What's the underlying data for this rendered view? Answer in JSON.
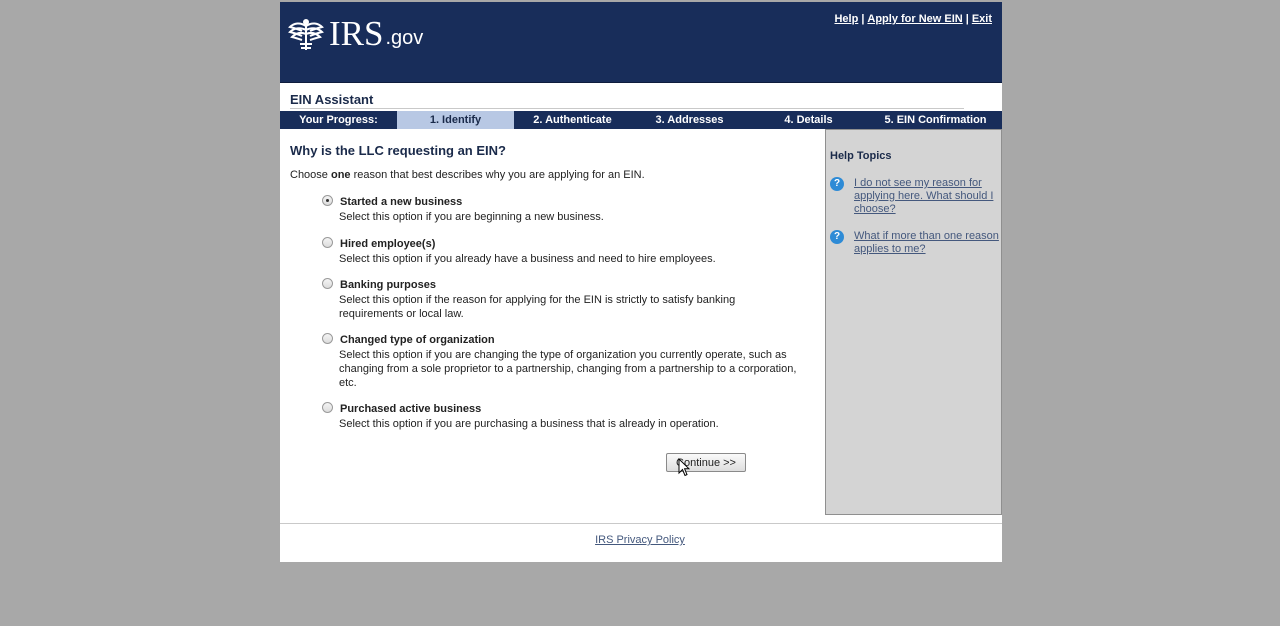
{
  "header": {
    "logo_main": "IRS",
    "logo_suffix": ".gov",
    "links": {
      "help": "Help",
      "apply": "Apply for New EIN",
      "exit": "Exit",
      "separator": "|"
    }
  },
  "app_title": "EIN Assistant",
  "progress": {
    "label": "Your Progress:",
    "steps": [
      "1. Identify",
      "2. Authenticate",
      "3. Addresses",
      "4. Details",
      "5. EIN Confirmation"
    ],
    "active_step": 1
  },
  "main": {
    "question": "Why is the LLC requesting an EIN?",
    "instruction_pre": "Choose ",
    "instruction_bold": "one",
    "instruction_post": " reason that best describes why you are applying for an EIN.",
    "options": [
      {
        "title": "Started a new business",
        "desc": "Select this option if you are beginning a new business.",
        "checked": true
      },
      {
        "title": "Hired employee(s)",
        "desc": "Select this option if you already have a business and need to hire employees.",
        "checked": false
      },
      {
        "title": "Banking purposes",
        "desc": "Select this option if the reason for applying for the EIN is strictly to satisfy banking requirements or local law.",
        "checked": false
      },
      {
        "title": "Changed type of organization",
        "desc": "Select this option if you are changing the type of organization you currently operate, such as changing from a sole proprietor to a partnership, changing from a partnership to a corporation, etc.",
        "checked": false
      },
      {
        "title": "Purchased active business",
        "desc": "Select this option if you are purchasing a business that is already in operation.",
        "checked": false
      }
    ],
    "continue_label": "Continue >>"
  },
  "help": {
    "title": "Help Topics",
    "items": [
      "I do not see my reason for applying here. What should I choose?",
      "What if more than one reason applies to me?"
    ],
    "icon_glyph": "?"
  },
  "footer": {
    "privacy_link": "IRS Privacy Policy"
  },
  "colors": {
    "header_bg": "#182d5a",
    "active_step_bg": "#b8c8e4",
    "help_panel_bg": "#d4d4d4",
    "help_icon": "#2e8bd6",
    "page_bg": "#a8a8a8"
  }
}
